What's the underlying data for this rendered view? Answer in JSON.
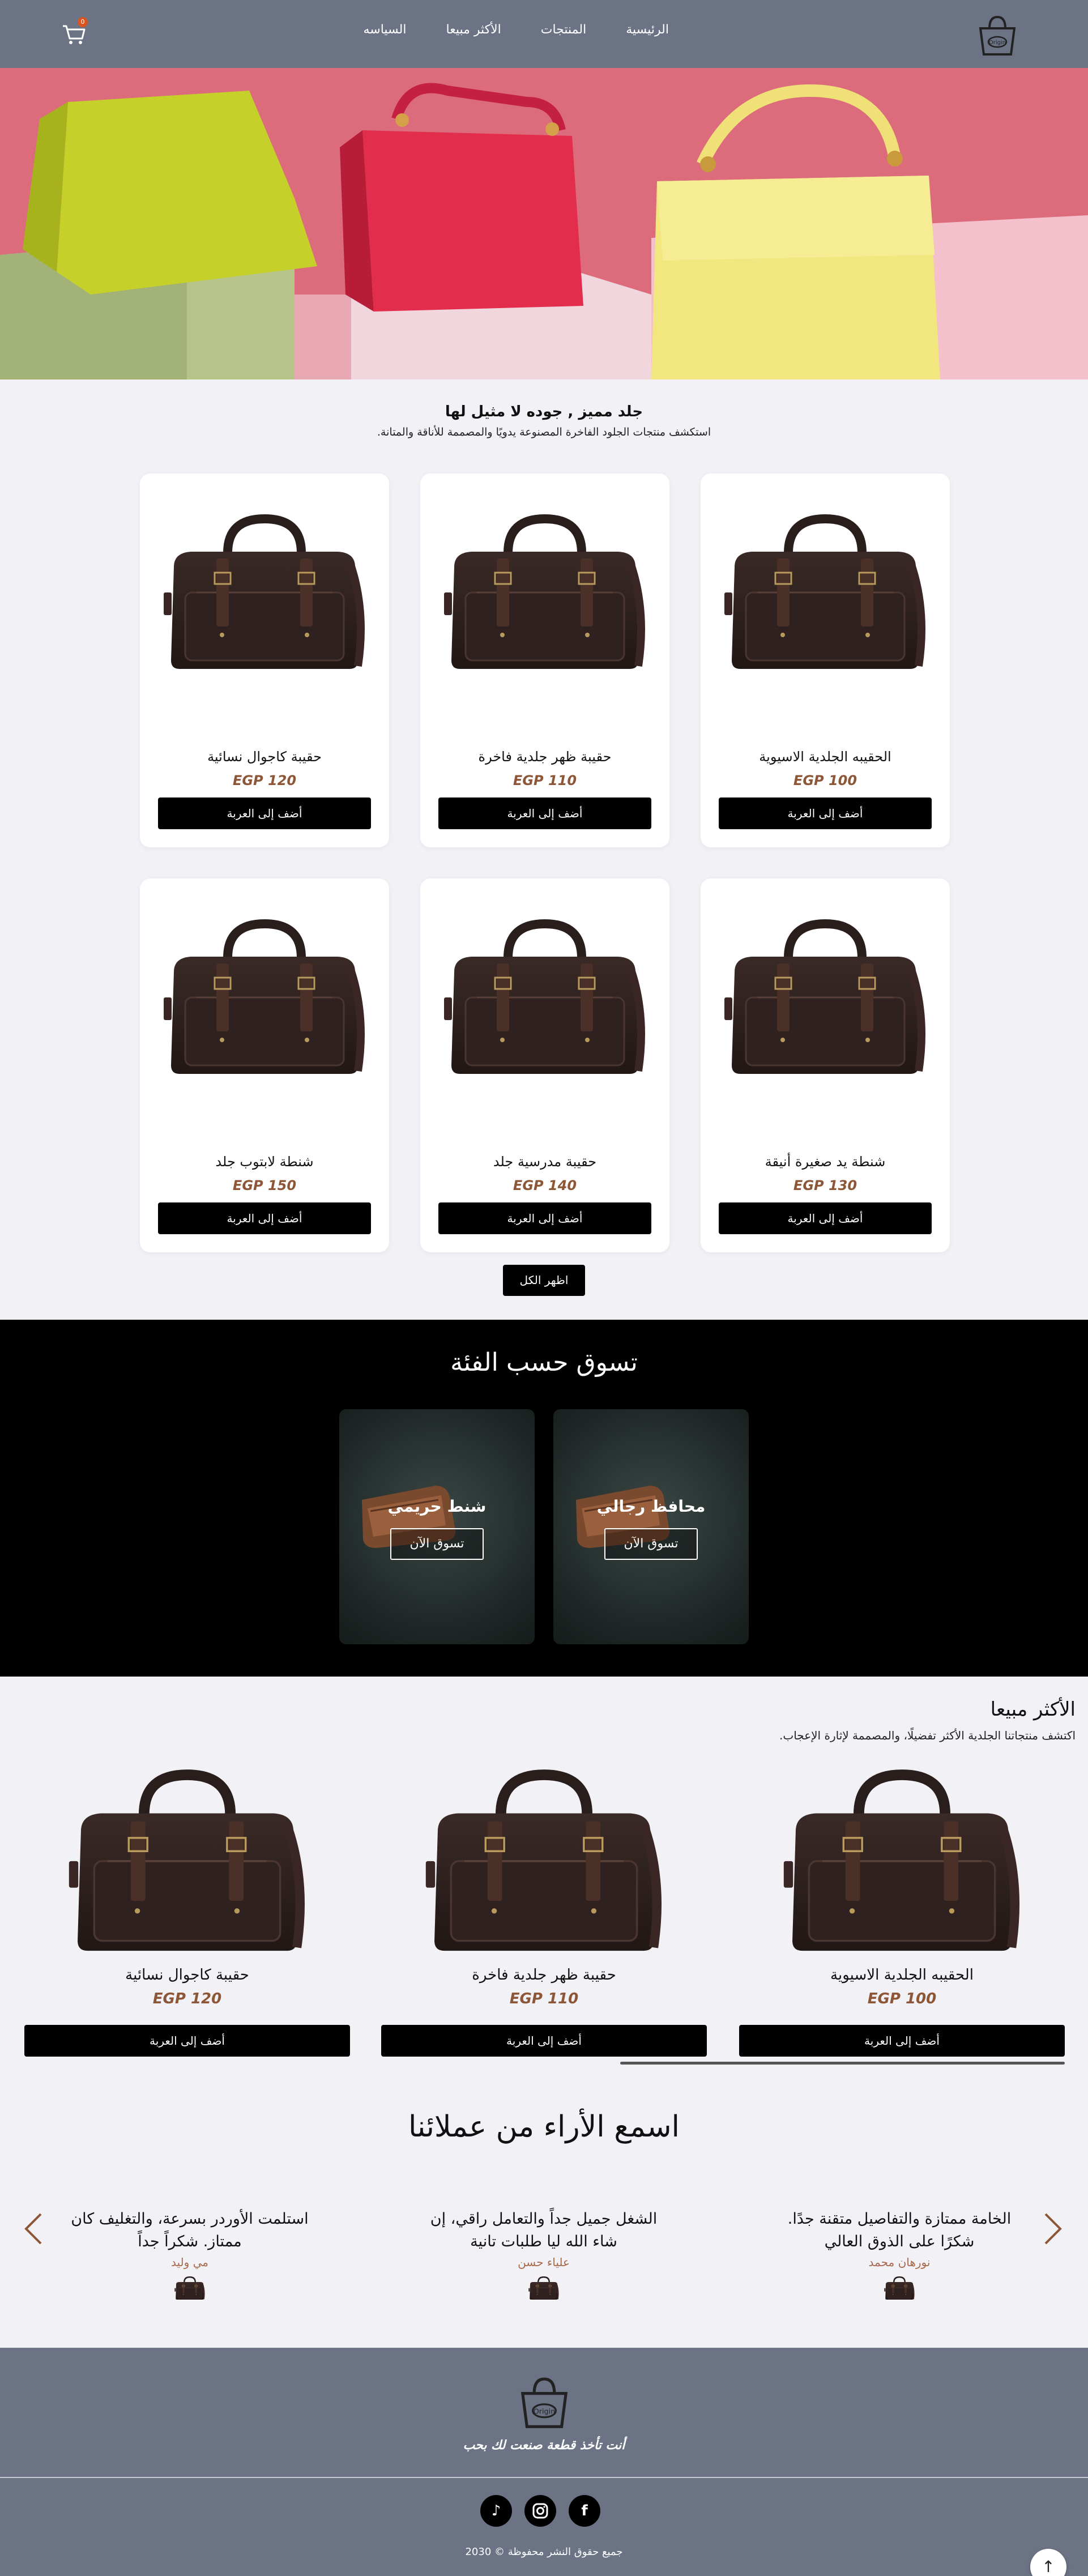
{
  "header": {
    "nav": [
      "الرئيسية",
      "المنتجات",
      "الأكثر مبيعا",
      "السياسه"
    ],
    "cart_count": "0"
  },
  "intro": {
    "title": "جلد مميز , جوده لا مثيل لها",
    "subtitle": "استكشف منتجات الجلود الفاخرة المصنوعة يدويًا والمصممة للأناقة والمتانة."
  },
  "products": [
    {
      "name": "الحقيبه الجلدية الاسيوية",
      "price": "EGP 100",
      "button": "أضف إلى العربة"
    },
    {
      "name": "حقيبة ظهر جلدية فاخرة",
      "price": "EGP 110",
      "button": "أضف إلى العربة"
    },
    {
      "name": "حقيبة كاجوال نسائية",
      "price": "EGP 120",
      "button": "أضف إلى العربة"
    },
    {
      "name": "شنطة يد صغيرة أنيقة",
      "price": "EGP 130",
      "button": "أضف إلى العربة"
    },
    {
      "name": "حقيبة مدرسية جلد",
      "price": "EGP 140",
      "button": "أضف إلى العربة"
    },
    {
      "name": "شنطة لابتوب جلد",
      "price": "EGP 150",
      "button": "أضف إلى العربة"
    }
  ],
  "show_all": "اظهر الكل",
  "categories": {
    "title": "تسوق حسب الفئة",
    "items": [
      {
        "label": "محافظ رجالي",
        "button": "تسوق الآن"
      },
      {
        "label": "شنط حريمي",
        "button": "تسوق الآن"
      }
    ]
  },
  "best_sellers": {
    "title": "الأكثر مبيعا",
    "subtitle": "اكتشف منتجاتنا الجلدية الأكثر تفضيلًا، والمصممة لإثارة الإعجاب.",
    "items": [
      {
        "name": "الحقيبه الجلدية الاسيوية",
        "price": "EGP 100",
        "button": "أضف إلى العربة"
      },
      {
        "name": "حقيبة ظهر جلدية فاخرة",
        "price": "EGP 110",
        "button": "أضف إلى العربة"
      },
      {
        "name": "حقيبة كاجوال نسائية",
        "price": "EGP 120",
        "button": "أضف إلى العربة"
      }
    ]
  },
  "testimonials": {
    "title": "اسمع الأراء من عملائنا",
    "items": [
      {
        "quote": "الخامة ممتازة والتفاصيل متقنة جدًا. شكرًا على الذوق العالي",
        "author": "نورهان محمد"
      },
      {
        "quote": "الشغل جميل جداً والتعامل راقي، إن شاء الله ليا طلبات تانية",
        "author": "علياء حسن"
      },
      {
        "quote": "استلمت الأوردر بسرعة، والتغليف كان ممتاز. شكراً جداً",
        "author": "مي وليد"
      }
    ]
  },
  "footer": {
    "tagline": "أنت تأخذ قطعة صنعت لك بحب",
    "copyright": "جميع حقوق النشر محفوظة © 2030"
  },
  "colors": {
    "header_bg": "#6b7385",
    "price": "#8c5637",
    "button_bg": "#000000"
  }
}
